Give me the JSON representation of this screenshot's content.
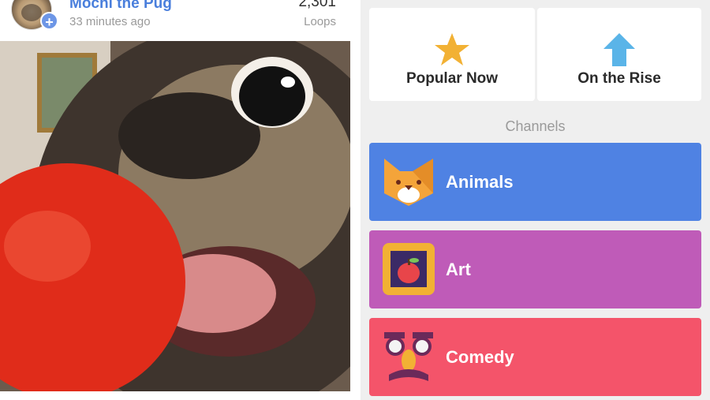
{
  "post": {
    "username": "Mochi the Pug",
    "time_ago": "33 minutes ago",
    "loops_count": "2,301",
    "loops_label": "Loops"
  },
  "explore": {
    "popular_label": "Popular Now",
    "rise_label": "On the Rise",
    "channels_heading": "Channels",
    "channels": [
      {
        "label": "Animals",
        "color": "#4f82e3",
        "icon": "cat-icon"
      },
      {
        "label": "Art",
        "color": "#bf5bb8",
        "icon": "framed-apple-icon"
      },
      {
        "label": "Comedy",
        "color": "#f4546a",
        "icon": "disguise-glasses-icon"
      }
    ]
  },
  "colors": {
    "accent_blue": "#4a7fdc",
    "star": "#f2b134",
    "rise_arrow": "#5ab4e8"
  }
}
